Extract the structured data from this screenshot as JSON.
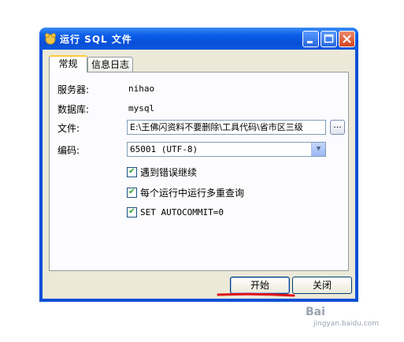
{
  "window": {
    "title": "运行 SQL 文件"
  },
  "tabs": [
    {
      "label": "常规"
    },
    {
      "label": "信息日志"
    }
  ],
  "fields": {
    "server": {
      "label": "服务器:",
      "value": "nihao"
    },
    "database": {
      "label": "数据库:",
      "value": "mysql"
    },
    "file": {
      "label": "文件:",
      "value": "E:\\王佛闪资料不要删除\\工具代码\\省市区三级",
      "browse_label": "..."
    },
    "encoding": {
      "label": "编码:",
      "value": "65001 (UTF-8)"
    }
  },
  "options": [
    {
      "label": "遇到错误继续",
      "checked": true
    },
    {
      "label": "每个运行中运行多重查询",
      "checked": true
    },
    {
      "label": "SET AUTOCOMMIT=0",
      "checked": true
    }
  ],
  "buttons": {
    "start": "开始",
    "close": "关闭"
  },
  "colors": {
    "underline": "#e0141c",
    "titlebar": "#0a4fd6"
  },
  "watermark": {
    "brand": "Bai",
    "url": "jingyan.baidu.com"
  }
}
